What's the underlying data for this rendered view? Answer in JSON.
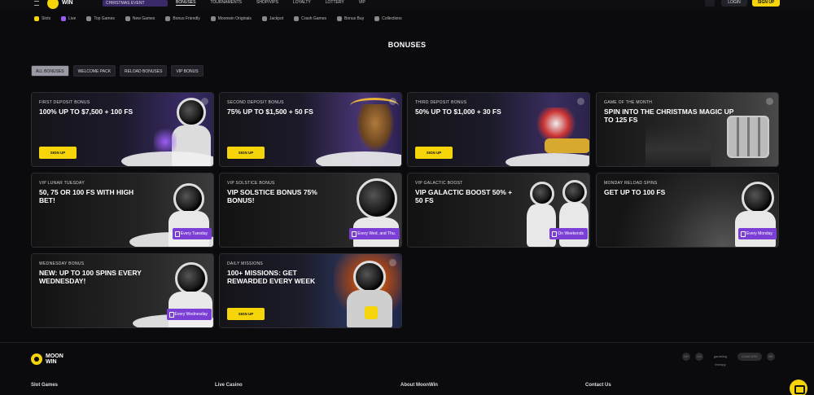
{
  "header": {
    "logo_text": "WIN",
    "promo_label": "CHRISTMAS EVENT",
    "nav": [
      "BONUSES",
      "TOURNAMENTS",
      "SHOP/VIPS",
      "LOYALTY",
      "LOTTERY",
      "VIP"
    ],
    "login_label": "LOGIN",
    "signup_label": "SIGN UP"
  },
  "categories": [
    {
      "label": "Slots",
      "color": "#f5d50a"
    },
    {
      "label": "Live",
      "color": "#9b5cf6"
    },
    {
      "label": "Top Games",
      "color": "#bbbbbb"
    },
    {
      "label": "New Games",
      "color": "#bbbbbb"
    },
    {
      "label": "Bonus Friendly",
      "color": "#bbbbbb"
    },
    {
      "label": "Moonwin Originals",
      "color": "#bbbbbb"
    },
    {
      "label": "Jackpot",
      "color": "#bbbbbb"
    },
    {
      "label": "Crash Games",
      "color": "#bbbbbb"
    },
    {
      "label": "Bonus Buy",
      "color": "#bbbbbb"
    },
    {
      "label": "Collections",
      "color": "#bbbbbb"
    }
  ],
  "page_title": "BONUSES",
  "filters": [
    "ALL BONUSES",
    "WELCOME PACK",
    "RELOAD BONUSES",
    "VIP BONUS"
  ],
  "cards": [
    {
      "label": "FIRST DEPOSIT BONUS",
      "title": "100% UP TO $7,500 + 100 FS",
      "cta": "SIGN UP"
    },
    {
      "label": "SECOND DEPOSIT BONUS",
      "title": "75% UP TO $1,500 + 50 FS",
      "cta": "SIGN UP"
    },
    {
      "label": "THIRD DEPOSIT BONUS",
      "title": "50% UP TO $1,000 + 30 FS",
      "cta": "SIGN UP"
    },
    {
      "label": "GAME OF THE MONTH",
      "title": "SPIN INTO THE CHRISTMAS MAGIC UP TO 125 FS"
    },
    {
      "label": "VIP LUNAR TUESDAY",
      "title": "50, 75 OR 100 FS WITH HIGH BET!",
      "badge": "Every Tuesday"
    },
    {
      "label": "VIP SOLSTICE BONUS",
      "title": "VIP SOLSTICE BONUS 75% BONUS!",
      "badge": "Every Wed. and Thu."
    },
    {
      "label": "VIP GALACTIC BOOST",
      "title": "VIP GALACTIC BOOST 50% + 50 FS",
      "badge": "On Weekends"
    },
    {
      "label": "MONDAY RELOAD SPINS",
      "title": "GET UP TO 100 FS",
      "badge": "Every Monday"
    },
    {
      "label": "WEDNESDAY BONUS",
      "title": "NEW: UP TO 100 SPINS EVERY WEDNESDAY!",
      "badge": "Every Wednesday"
    },
    {
      "label": "DAILY MISSIONS",
      "title": "100+ MISSIONS: GET REWARDED EVERY WEEK",
      "cta": "SIGN UP"
    }
  ],
  "footer": {
    "logo_line1": "MOON",
    "logo_line2": "WIN",
    "partners": [
      "18+",
      "GA",
      "gambling therapy",
      "GAMCARE",
      "BE"
    ],
    "columns": [
      "Slot Games",
      "Live Casino",
      "About MoonWin",
      "Contact Us"
    ]
  }
}
